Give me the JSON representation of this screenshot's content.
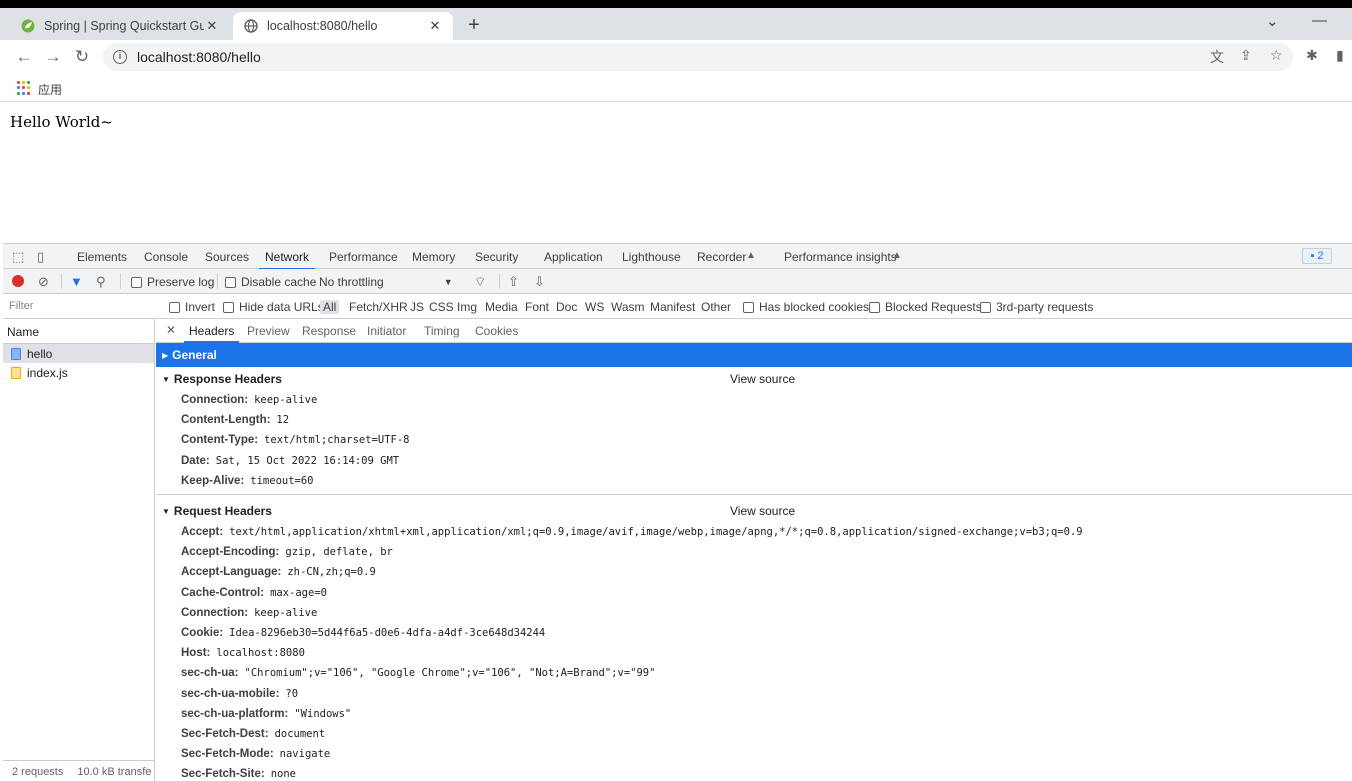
{
  "browser": {
    "tabs": [
      {
        "title": "Spring | Spring Quickstart Gui",
        "favicon": "spring-leaf-icon"
      },
      {
        "title": "localhost:8080/hello",
        "favicon": "globe-icon"
      }
    ],
    "url": "localhost:8080/hello",
    "bookmarks_label": "应用",
    "accent": "#1a73e8"
  },
  "page": {
    "content": "Hello World~"
  },
  "devtools": {
    "tabs": [
      "Elements",
      "Console",
      "Sources",
      "Network",
      "Performance",
      "Memory",
      "Security",
      "Application",
      "Lighthouse",
      "Recorder",
      "Performance insights"
    ],
    "selected_tab": "Network",
    "issues_count": "2",
    "network_toolbar": {
      "preserve_log": "Preserve log",
      "disable_cache": "Disable cache",
      "throttling": "No throttling"
    },
    "filter_bar": {
      "placeholder": "Filter",
      "invert": "Invert",
      "hide_data_urls": "Hide data URLs",
      "types": [
        "All",
        "Fetch/XHR",
        "JS",
        "CSS",
        "Img",
        "Media",
        "Font",
        "Doc",
        "WS",
        "Wasm",
        "Manifest",
        "Other"
      ],
      "has_blocked_cookies": "Has blocked cookies",
      "blocked_requests": "Blocked Requests",
      "third_party": "3rd-party requests"
    },
    "requests": {
      "column_name": "Name",
      "items": [
        {
          "name": "hello",
          "icon": "document-icon"
        },
        {
          "name": "index.js",
          "icon": "script-icon"
        }
      ],
      "summary_count": "2 requests",
      "summary_transfer": "10.0 kB transfe"
    },
    "detail": {
      "tabs": [
        "Headers",
        "Preview",
        "Response",
        "Initiator",
        "Timing",
        "Cookies"
      ],
      "general_label": "General",
      "response_headers_label": "Response Headers",
      "request_headers_label": "Request Headers",
      "view_source": "View source",
      "response_headers": [
        {
          "k": "Connection:",
          "v": "keep-alive"
        },
        {
          "k": "Content-Length:",
          "v": "12"
        },
        {
          "k": "Content-Type:",
          "v": "text/html;charset=UTF-8"
        },
        {
          "k": "Date:",
          "v": "Sat, 15 Oct 2022 16:14:09 GMT"
        },
        {
          "k": "Keep-Alive:",
          "v": "timeout=60"
        }
      ],
      "request_headers": [
        {
          "k": "Accept:",
          "v": "text/html,application/xhtml+xml,application/xml;q=0.9,image/avif,image/webp,image/apng,*/*;q=0.8,application/signed-exchange;v=b3;q=0.9"
        },
        {
          "k": "Accept-Encoding:",
          "v": "gzip, deflate, br"
        },
        {
          "k": "Accept-Language:",
          "v": "zh-CN,zh;q=0.9"
        },
        {
          "k": "Cache-Control:",
          "v": "max-age=0"
        },
        {
          "k": "Connection:",
          "v": "keep-alive"
        },
        {
          "k": "Cookie:",
          "v": "Idea-8296eb30=5d44f6a5-d0e6-4dfa-a4df-3ce648d34244"
        },
        {
          "k": "Host:",
          "v": "localhost:8080"
        },
        {
          "k": "sec-ch-ua:",
          "v": "\"Chromium\";v=\"106\", \"Google Chrome\";v=\"106\", \"Not;A=Brand\";v=\"99\""
        },
        {
          "k": "sec-ch-ua-mobile:",
          "v": "?0"
        },
        {
          "k": "sec-ch-ua-platform:",
          "v": "\"Windows\""
        },
        {
          "k": "Sec-Fetch-Dest:",
          "v": "document"
        },
        {
          "k": "Sec-Fetch-Mode:",
          "v": "navigate"
        },
        {
          "k": "Sec-Fetch-Site:",
          "v": "none"
        }
      ]
    }
  }
}
